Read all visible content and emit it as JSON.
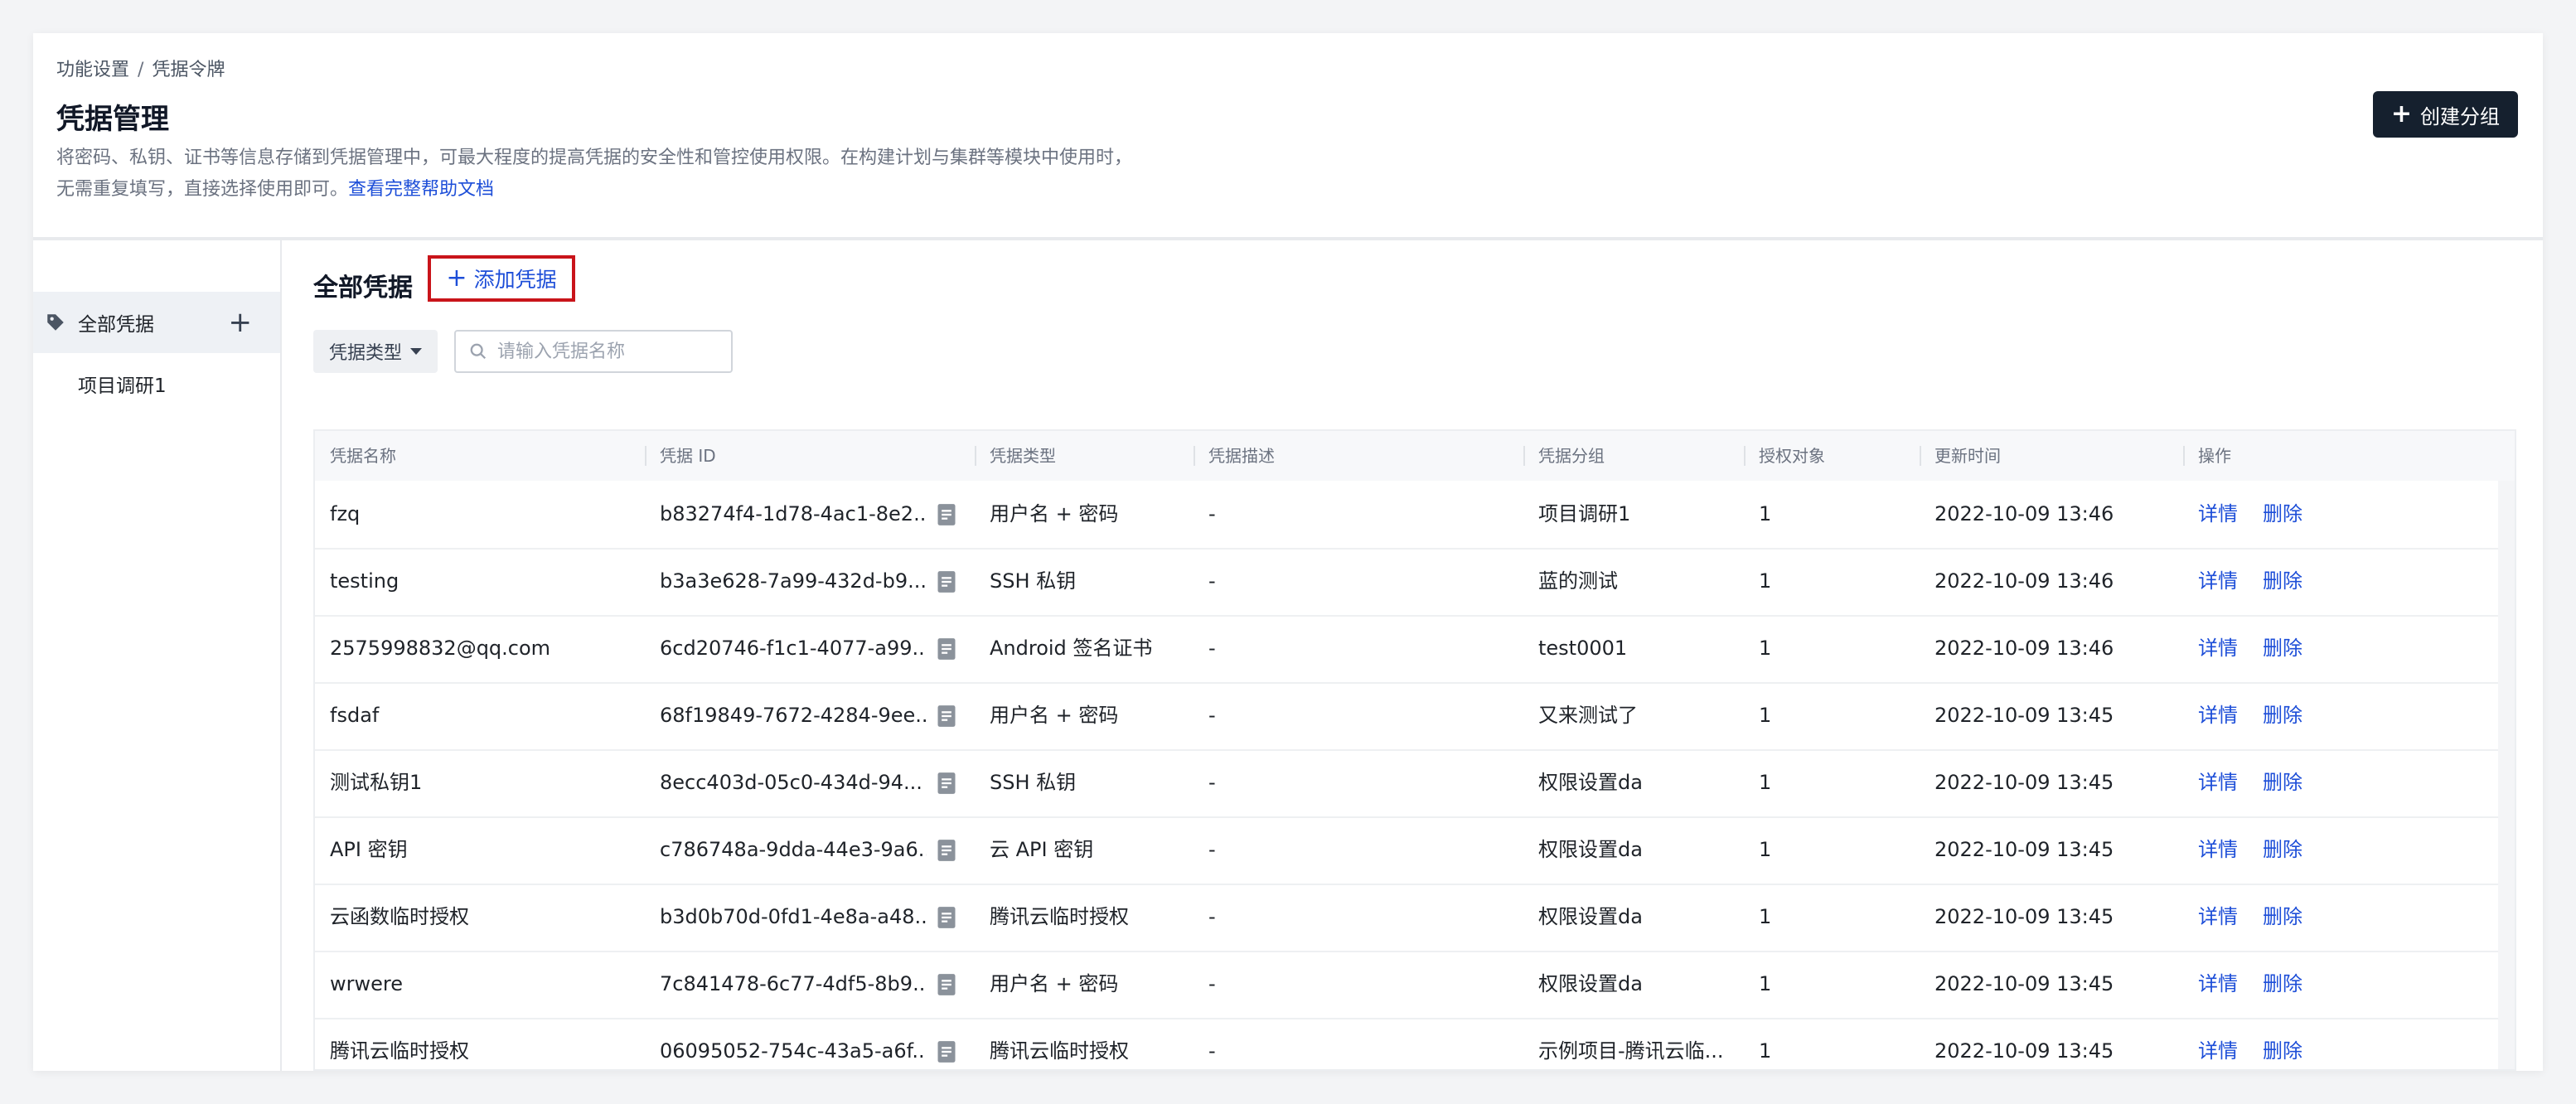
{
  "header": {
    "breadcrumb": [
      "功能设置",
      "凭据令牌"
    ],
    "breadcrumb_sep": "/",
    "title": "凭据管理",
    "description_line1": "将密码、私钥、证书等信息存储到凭据管理中，可最大程度的提高凭据的安全性和管控使用权限。在构建计划与集群等模块中使用时，",
    "description_line2": "无需重复填写，直接选择使用即可。",
    "help_link": "查看完整帮助文档",
    "create_group_label": "创建分组"
  },
  "sidebar": {
    "items": [
      {
        "label": "全部凭据",
        "active": true,
        "icon": "tag-icon"
      },
      {
        "label": "项目调研1",
        "active": false
      }
    ]
  },
  "main": {
    "section_title": "全部凭据",
    "add_credential_label": "添加凭据",
    "filter_type_label": "凭据类型",
    "search": {
      "placeholder": "请输入凭据名称",
      "value": ""
    }
  },
  "table": {
    "columns": [
      "凭据名称",
      "凭据 ID",
      "凭据类型",
      "凭据描述",
      "凭据分组",
      "授权对象",
      "更新时间",
      "操作"
    ],
    "rows": [
      {
        "name": "fzq",
        "id": "b83274f4-1d78-4ac1-8e2...",
        "type": "用户名 + 密码",
        "desc": "-",
        "group": "项目调研1",
        "auth": "1",
        "updated": "2022-10-09 13:46"
      },
      {
        "name": "testing",
        "id": "b3a3e628-7a99-432d-b9...",
        "type": "SSH 私钥",
        "desc": "-",
        "group": "蓝的测试",
        "auth": "1",
        "updated": "2022-10-09 13:46"
      },
      {
        "name": "2575998832@qq.com",
        "id": "6cd20746-f1c1-4077-a99...",
        "type": "Android 签名证书",
        "desc": "-",
        "group": "test0001",
        "auth": "1",
        "updated": "2022-10-09 13:46"
      },
      {
        "name": "fsdaf",
        "id": "68f19849-7672-4284-9ee...",
        "type": "用户名 + 密码",
        "desc": "-",
        "group": "又来测试了",
        "auth": "1",
        "updated": "2022-10-09 13:45"
      },
      {
        "name": "测试私钥1",
        "id": "8ecc403d-05c0-434d-94...",
        "type": "SSH 私钥",
        "desc": "-",
        "group": "权限设置da",
        "auth": "1",
        "updated": "2022-10-09 13:45"
      },
      {
        "name": "API 密钥",
        "id": "c786748a-9dda-44e3-9a6...",
        "type": "云 API 密钥",
        "desc": "-",
        "group": "权限设置da",
        "auth": "1",
        "updated": "2022-10-09 13:45"
      },
      {
        "name": "云函数临时授权",
        "id": "b3d0b70d-0fd1-4e8a-a48...",
        "type": "腾讯云临时授权",
        "desc": "-",
        "group": "权限设置da",
        "auth": "1",
        "updated": "2022-10-09 13:45"
      },
      {
        "name": "wrwere",
        "id": "7c841478-6c77-4df5-8b9...",
        "type": "用户名 + 密码",
        "desc": "-",
        "group": "权限设置da",
        "auth": "1",
        "updated": "2022-10-09 13:45"
      },
      {
        "name": "腾讯云临时授权",
        "id": "06095052-754c-43a5-a6f...",
        "type": "腾讯云临时授权",
        "desc": "-",
        "group": "示例项目-腾讯云临...",
        "auth": "1",
        "updated": "2022-10-09 13:45"
      }
    ],
    "actions": {
      "detail": "详情",
      "delete": "删除"
    }
  },
  "colors": {
    "accent": "#1d4ed8",
    "dark_button": "#15202e",
    "highlight_border": "#c9141a"
  }
}
